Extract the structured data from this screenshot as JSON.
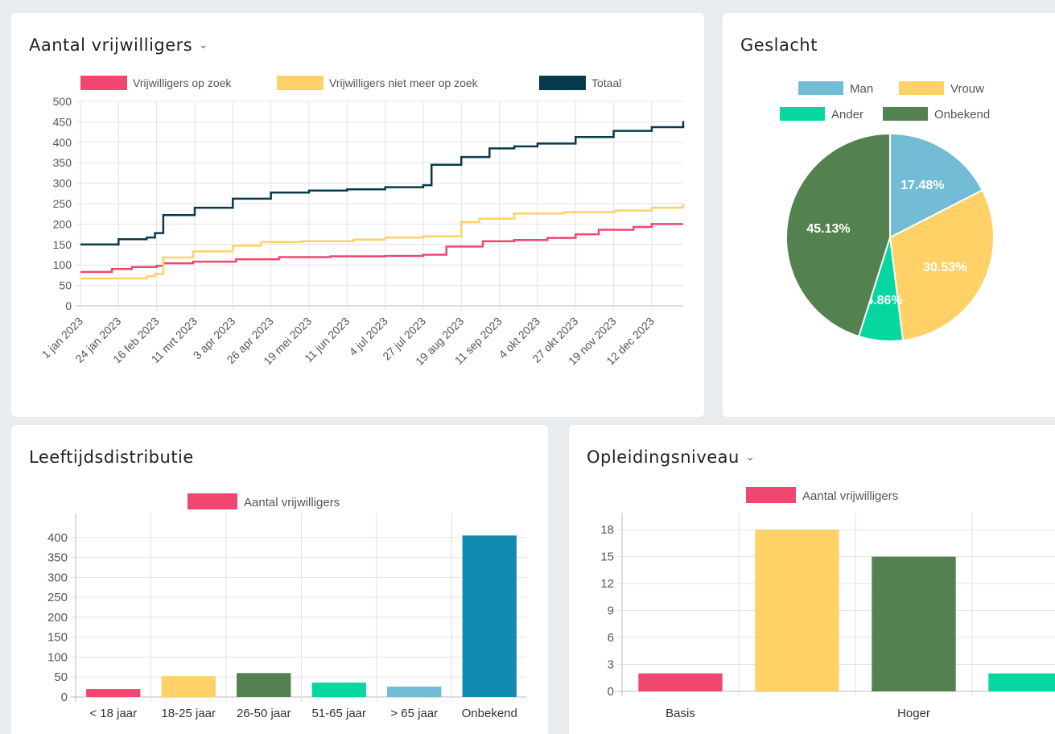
{
  "cards": {
    "volunteers": {
      "title": "Aantal vrijwilligers",
      "has_dropdown": true
    },
    "gender": {
      "title": "Geslacht"
    },
    "age": {
      "title": "Leeftijdsdistributie"
    },
    "education": {
      "title": "Opleidingsniveau",
      "has_dropdown": true
    }
  },
  "chart_data": [
    {
      "id": "volunteers",
      "type": "line",
      "title": "Aantal vrijwilligers",
      "ylim": [
        0,
        500
      ],
      "yticks": [
        0,
        50,
        100,
        150,
        200,
        250,
        300,
        350,
        400,
        450,
        500
      ],
      "xlim": [
        "2023-01-01",
        "2023-12-31"
      ],
      "xtick_labels": [
        "1 jan 2023",
        "24 jan 2023",
        "16 feb 2023",
        "11 mrt 2023",
        "3 apr 2023",
        "26 apr 2023",
        "19 mei 2023",
        "11 jun 2023",
        "4 jul 2023",
        "27 jul 2023",
        "19 aug 2023",
        "11 sep 2023",
        "4 okt 2023",
        "27 okt 2023",
        "19 nov 2023",
        "12 dec 2023"
      ],
      "xtick_dates": [
        "2023-01-01",
        "2023-01-24",
        "2023-02-16",
        "2023-03-11",
        "2023-04-03",
        "2023-04-26",
        "2023-05-19",
        "2023-06-11",
        "2023-07-04",
        "2023-07-27",
        "2023-08-19",
        "2023-09-11",
        "2023-10-04",
        "2023-10-27",
        "2023-11-19",
        "2023-12-12"
      ],
      "grid": true,
      "legend_position": "top",
      "series": [
        {
          "name": "Vrijwilligers op zoek",
          "color": "#ef476f",
          "x": [
            "2023-01-01",
            "2023-01-20",
            "2023-02-01",
            "2023-02-16",
            "2023-02-20",
            "2023-03-10",
            "2023-04-05",
            "2023-05-01",
            "2023-06-01",
            "2023-07-04",
            "2023-07-27",
            "2023-08-10",
            "2023-09-01",
            "2023-09-20",
            "2023-10-10",
            "2023-10-27",
            "2023-11-10",
            "2023-12-01",
            "2023-12-12",
            "2023-12-31"
          ],
          "values": [
            83,
            90,
            95,
            98,
            104,
            108,
            114,
            119,
            121,
            122,
            125,
            145,
            158,
            161,
            166,
            175,
            186,
            193,
            200,
            200
          ]
        },
        {
          "name": "Vrijwilligers niet meer op zoek",
          "color": "#ffd166",
          "x": [
            "2023-01-01",
            "2023-02-10",
            "2023-02-15",
            "2023-02-20",
            "2023-03-10",
            "2023-04-03",
            "2023-04-20",
            "2023-05-15",
            "2023-06-15",
            "2023-07-04",
            "2023-07-27",
            "2023-08-19",
            "2023-08-30",
            "2023-09-20",
            "2023-10-20",
            "2023-11-20",
            "2023-12-12",
            "2023-12-31"
          ],
          "values": [
            67,
            72,
            78,
            118,
            133,
            147,
            156,
            158,
            162,
            167,
            170,
            205,
            213,
            226,
            229,
            233,
            240,
            250
          ]
        },
        {
          "name": "Totaal",
          "color": "#073b4c",
          "x": [
            "2023-01-01",
            "2023-01-24",
            "2023-02-10",
            "2023-02-15",
            "2023-02-20",
            "2023-03-11",
            "2023-04-03",
            "2023-04-26",
            "2023-05-19",
            "2023-06-11",
            "2023-07-04",
            "2023-07-27",
            "2023-08-01",
            "2023-08-19",
            "2023-09-05",
            "2023-09-20",
            "2023-10-04",
            "2023-10-27",
            "2023-11-19",
            "2023-12-12",
            "2023-12-31"
          ],
          "values": [
            150,
            163,
            167,
            178,
            222,
            240,
            262,
            277,
            282,
            285,
            290,
            295,
            345,
            364,
            385,
            390,
            397,
            413,
            428,
            437,
            452
          ]
        }
      ]
    },
    {
      "id": "gender",
      "type": "pie",
      "title": "Geslacht",
      "legend_position": "top",
      "slices": [
        {
          "label": "Man",
          "value": 17.48,
          "display": "17.48%",
          "color": "#73bcd6"
        },
        {
          "label": "Vrouw",
          "value": 30.53,
          "display": "30.53%",
          "color": "#ffd166"
        },
        {
          "label": "Ander",
          "value": 6.86,
          "display": "6.86%",
          "color": "#06d6a0"
        },
        {
          "label": "Onbekend",
          "value": 45.13,
          "display": "45.13%",
          "color": "#548150"
        }
      ]
    },
    {
      "id": "age",
      "type": "bar",
      "title": "Leeftijdsdistributie",
      "legend": "Aantal vrijwilligers",
      "legend_color": "#ef476f",
      "categories": [
        "< 18 jaar",
        "18-25 jaar",
        "26-50 jaar",
        "51-65 jaar",
        "> 65 jaar",
        "Onbekend"
      ],
      "values": [
        20,
        52,
        60,
        36,
        26,
        405
      ],
      "colors": [
        "#ef476f",
        "#ffd166",
        "#548150",
        "#06d6a0",
        "#73bcd6",
        "#118ab2"
      ],
      "ylim": [
        0,
        440
      ],
      "yticks": [
        0,
        50,
        100,
        150,
        200,
        250,
        300,
        350,
        400
      ],
      "grid": true
    },
    {
      "id": "education",
      "type": "bar",
      "title": "Opleidingsniveau",
      "legend": "Aantal vrijwilligers",
      "legend_color": "#ef476f",
      "categories": [
        "Basis",
        "",
        "Hoger",
        ""
      ],
      "values": [
        2,
        18,
        15,
        2
      ],
      "colors": [
        "#ef476f",
        "#ffd166",
        "#548150",
        "#06d6a0"
      ],
      "ylim": [
        0,
        19
      ],
      "yticks": [
        0,
        3,
        6,
        9,
        12,
        15,
        18
      ],
      "grid": true
    }
  ]
}
